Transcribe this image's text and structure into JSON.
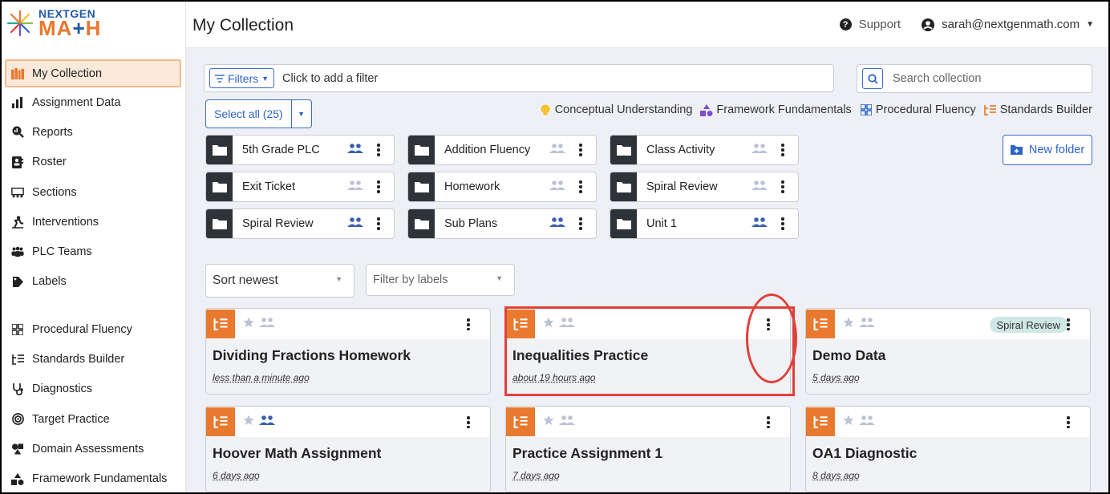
{
  "logo": {
    "line1": "NEXTGEN",
    "line2a": "MA",
    "line2b": "+",
    "line2c": "H"
  },
  "header": {
    "title": "My Collection",
    "support": "Support",
    "user": "sarah@nextgenmath.com"
  },
  "sidebar": {
    "items": [
      {
        "label": "My Collection",
        "icon": "books-icon"
      },
      {
        "label": "Assignment Data",
        "icon": "bar-chart-icon"
      },
      {
        "label": "Reports",
        "icon": "magnify-chart-icon"
      },
      {
        "label": "Roster",
        "icon": "roster-icon"
      },
      {
        "label": "Sections",
        "icon": "sections-icon"
      },
      {
        "label": "Interventions",
        "icon": "interventions-icon"
      },
      {
        "label": "PLC Teams",
        "icon": "team-icon"
      },
      {
        "label": "Labels",
        "icon": "tag-icon"
      }
    ],
    "tools": [
      {
        "label": "Procedural Fluency",
        "icon": "grid-icon"
      },
      {
        "label": "Standards Builder",
        "icon": "standards-icon"
      },
      {
        "label": "Diagnostics",
        "icon": "stethoscope-icon"
      },
      {
        "label": "Target Practice",
        "icon": "target-icon"
      },
      {
        "label": "Domain Assessments",
        "icon": "shapes-icon"
      },
      {
        "label": "Framework Fundamentals",
        "icon": "framework-icon"
      }
    ]
  },
  "toolbar": {
    "filters_label": "Filters",
    "filter_placeholder": "Click to add a filter",
    "search_placeholder": "Search collection",
    "select_all": "Select all (25)",
    "new_folder": "New folder"
  },
  "legend": [
    {
      "label": "Conceptual Understanding",
      "color": "#f5c12e"
    },
    {
      "label": "Framework Fundamentals",
      "color": "#7d4bd1"
    },
    {
      "label": "Procedural Fluency",
      "color": "#2f64c7"
    },
    {
      "label": "Standards Builder",
      "color": "#e8792f"
    }
  ],
  "folders": [
    {
      "name": "5th Grade PLC",
      "shared": true
    },
    {
      "name": "Addition Fluency",
      "shared": false
    },
    {
      "name": "Class Activity",
      "shared": false
    },
    {
      "name": "Exit Ticket",
      "shared": false
    },
    {
      "name": "Homework",
      "shared": false
    },
    {
      "name": "Spiral Review",
      "shared": false
    },
    {
      "name": "Spiral Review",
      "shared": true
    },
    {
      "name": "Sub Plans",
      "shared": true
    },
    {
      "name": "Unit 1",
      "shared": true
    }
  ],
  "sort": {
    "value": "Sort newest",
    "label_placeholder": "Filter by labels"
  },
  "cards": [
    {
      "title": "Dividing Fractions Homework",
      "time": "less than a minute ago",
      "shared": false,
      "tag": ""
    },
    {
      "title": "Inequalities Practice",
      "time": "about 19 hours ago",
      "shared": false,
      "tag": ""
    },
    {
      "title": "Demo Data",
      "time": "5 days ago",
      "shared": false,
      "tag": "Spiral Review"
    },
    {
      "title": "Hoover Math Assignment",
      "time": "6 days ago",
      "shared": true,
      "tag": ""
    },
    {
      "title": "Practice Assignment 1",
      "time": "7 days ago",
      "shared": false,
      "tag": ""
    },
    {
      "title": "OA1 Diagnostic",
      "time": "8 days ago",
      "shared": false,
      "tag": ""
    }
  ]
}
